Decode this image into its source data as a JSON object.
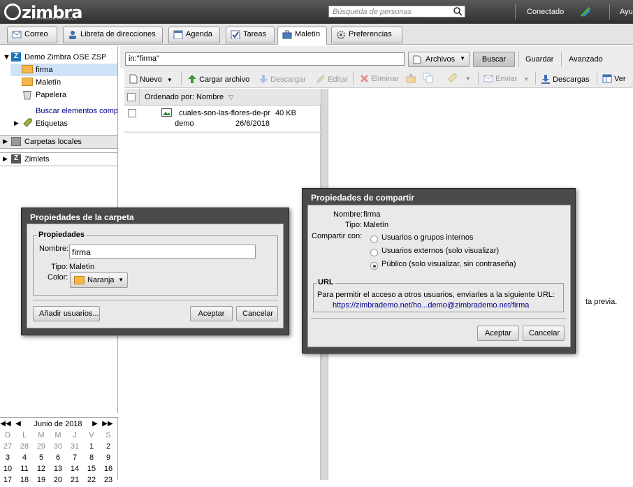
{
  "app": {
    "logo": "zimbra",
    "logo_sub": "A SYNACOR PRODUCT"
  },
  "header": {
    "search_placeholder": "Búsqueda de personas",
    "status": "Conectado",
    "help": "Ayu"
  },
  "tabs": [
    {
      "label": "Correo",
      "icon": "mail-icon"
    },
    {
      "label": "Libreta de direcciones",
      "icon": "contacts-icon"
    },
    {
      "label": "Agenda",
      "icon": "calendar-icon"
    },
    {
      "label": "Tareas",
      "icon": "tasks-icon"
    },
    {
      "label": "Maletín",
      "icon": "briefcase-icon",
      "active": true
    },
    {
      "label": "Preferencias",
      "icon": "gear-icon"
    }
  ],
  "sidebar": {
    "account": "Demo Zimbra OSE ZSP",
    "folders": [
      "firma",
      "Maletín",
      "Papelera"
    ],
    "search_link": "Buscar elementos comp",
    "tags": "Etiquetas",
    "local": "Carpetas locales",
    "zimlets": "Zimlets"
  },
  "calendar": {
    "month": "Junio de 2018",
    "days": [
      "D",
      "L",
      "M",
      "M",
      "J",
      "V",
      "S"
    ],
    "weeks": [
      [
        "27",
        "28",
        "29",
        "30",
        "31",
        "1",
        "2"
      ],
      [
        "3",
        "4",
        "5",
        "6",
        "7",
        "8",
        "9"
      ],
      [
        "10",
        "11",
        "12",
        "13",
        "14",
        "15",
        "16"
      ],
      [
        "17",
        "18",
        "19",
        "20",
        "21",
        "22",
        "23"
      ]
    ]
  },
  "query": {
    "value": "in:\"firma\"",
    "scope": "Archivos",
    "search": "Buscar",
    "save": "Guardar",
    "advanced": "Avanzado"
  },
  "toolbar": {
    "new": "Nuevo",
    "upload": "Cargar archivo",
    "download": "Descargar",
    "edit": "Editar",
    "delete": "Eliminar",
    "send": "Enviar",
    "downloads": "Descargas",
    "view": "Ver"
  },
  "list": {
    "sort": "Ordenado por: Nombre",
    "items": [
      {
        "name": "cuales-son-las-flores-de-pr",
        "size": "40 KB",
        "owner": "demo",
        "date": "26/6/2018"
      }
    ]
  },
  "preview_text": "ta previa.",
  "folder_dialog": {
    "title": "Propiedades de la carpeta",
    "section": "Propiedades",
    "name_label": "Nombre:",
    "name_value": "firma",
    "type_label": "Tipo:",
    "type_value": "Maletín",
    "color_label": "Color:",
    "color_value": "Naranja",
    "add_users": "Añadir usuarios...",
    "ok": "Aceptar",
    "cancel": "Cancelar"
  },
  "share_dialog": {
    "title": "Propiedades de compartir",
    "name_label": "Nombre:",
    "name_value": "firma",
    "type_label": "Tipo:",
    "type_value": "Maletín",
    "share_label": "Compartir con:",
    "options": [
      "Usuarios o grupos internos",
      "Usuarios externos (solo visualizar)",
      "Público (solo visualizar, sin contraseña)"
    ],
    "selected_option": 2,
    "url_section": "URL",
    "url_text": "Para permitir el acceso a otros usuarios, enviarles a la siguiente URL:",
    "url": "https://zimbrademo.net/ho...demo@zimbrademo.net/firma",
    "ok": "Aceptar",
    "cancel": "Cancelar"
  }
}
